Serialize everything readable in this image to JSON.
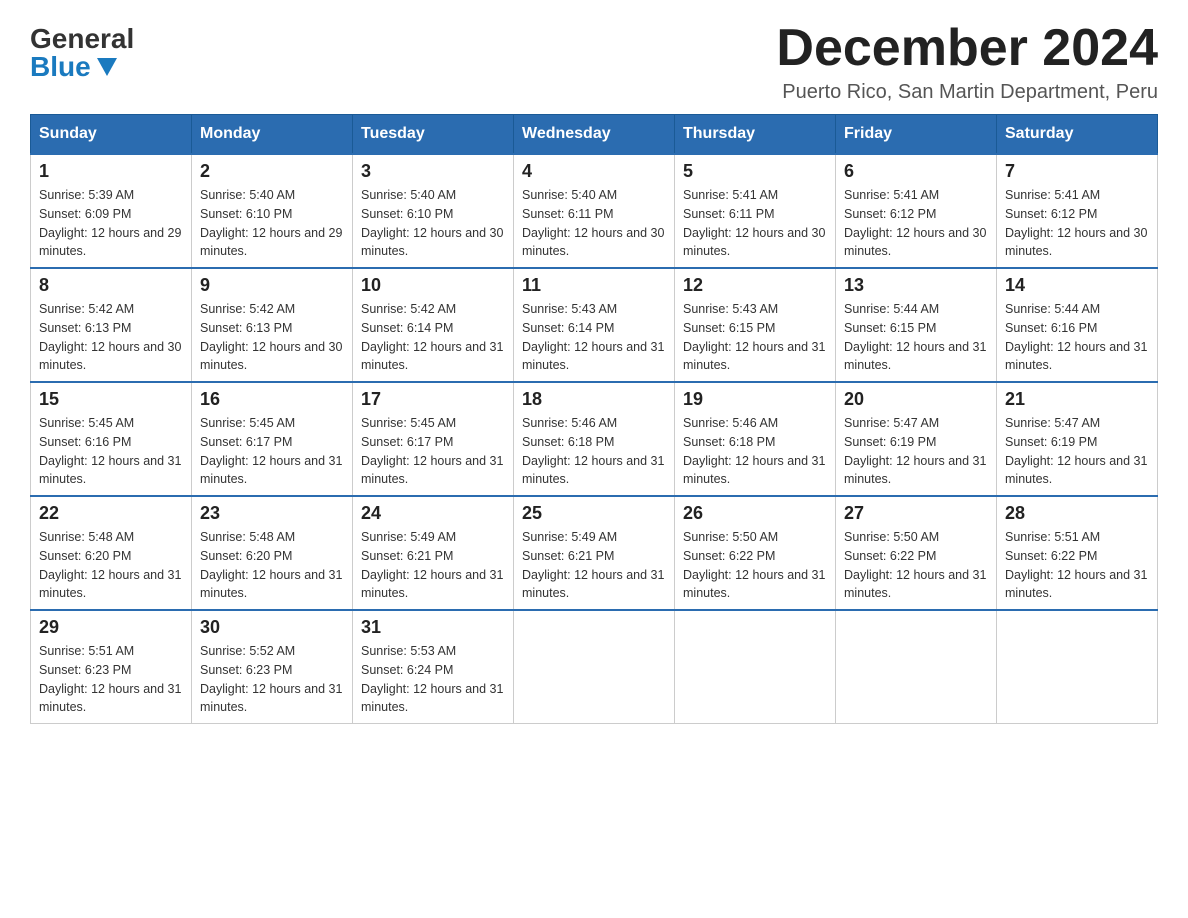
{
  "logo": {
    "general": "General",
    "blue": "Blue"
  },
  "title": {
    "month": "December 2024",
    "location": "Puerto Rico, San Martin Department, Peru"
  },
  "weekdays": [
    "Sunday",
    "Monday",
    "Tuesday",
    "Wednesday",
    "Thursday",
    "Friday",
    "Saturday"
  ],
  "weeks": [
    [
      {
        "day": "1",
        "sunrise": "5:39 AM",
        "sunset": "6:09 PM",
        "daylight": "12 hours and 29 minutes."
      },
      {
        "day": "2",
        "sunrise": "5:40 AM",
        "sunset": "6:10 PM",
        "daylight": "12 hours and 29 minutes."
      },
      {
        "day": "3",
        "sunrise": "5:40 AM",
        "sunset": "6:10 PM",
        "daylight": "12 hours and 30 minutes."
      },
      {
        "day": "4",
        "sunrise": "5:40 AM",
        "sunset": "6:11 PM",
        "daylight": "12 hours and 30 minutes."
      },
      {
        "day": "5",
        "sunrise": "5:41 AM",
        "sunset": "6:11 PM",
        "daylight": "12 hours and 30 minutes."
      },
      {
        "day": "6",
        "sunrise": "5:41 AM",
        "sunset": "6:12 PM",
        "daylight": "12 hours and 30 minutes."
      },
      {
        "day": "7",
        "sunrise": "5:41 AM",
        "sunset": "6:12 PM",
        "daylight": "12 hours and 30 minutes."
      }
    ],
    [
      {
        "day": "8",
        "sunrise": "5:42 AM",
        "sunset": "6:13 PM",
        "daylight": "12 hours and 30 minutes."
      },
      {
        "day": "9",
        "sunrise": "5:42 AM",
        "sunset": "6:13 PM",
        "daylight": "12 hours and 30 minutes."
      },
      {
        "day": "10",
        "sunrise": "5:42 AM",
        "sunset": "6:14 PM",
        "daylight": "12 hours and 31 minutes."
      },
      {
        "day": "11",
        "sunrise": "5:43 AM",
        "sunset": "6:14 PM",
        "daylight": "12 hours and 31 minutes."
      },
      {
        "day": "12",
        "sunrise": "5:43 AM",
        "sunset": "6:15 PM",
        "daylight": "12 hours and 31 minutes."
      },
      {
        "day": "13",
        "sunrise": "5:44 AM",
        "sunset": "6:15 PM",
        "daylight": "12 hours and 31 minutes."
      },
      {
        "day": "14",
        "sunrise": "5:44 AM",
        "sunset": "6:16 PM",
        "daylight": "12 hours and 31 minutes."
      }
    ],
    [
      {
        "day": "15",
        "sunrise": "5:45 AM",
        "sunset": "6:16 PM",
        "daylight": "12 hours and 31 minutes."
      },
      {
        "day": "16",
        "sunrise": "5:45 AM",
        "sunset": "6:17 PM",
        "daylight": "12 hours and 31 minutes."
      },
      {
        "day": "17",
        "sunrise": "5:45 AM",
        "sunset": "6:17 PM",
        "daylight": "12 hours and 31 minutes."
      },
      {
        "day": "18",
        "sunrise": "5:46 AM",
        "sunset": "6:18 PM",
        "daylight": "12 hours and 31 minutes."
      },
      {
        "day": "19",
        "sunrise": "5:46 AM",
        "sunset": "6:18 PM",
        "daylight": "12 hours and 31 minutes."
      },
      {
        "day": "20",
        "sunrise": "5:47 AM",
        "sunset": "6:19 PM",
        "daylight": "12 hours and 31 minutes."
      },
      {
        "day": "21",
        "sunrise": "5:47 AM",
        "sunset": "6:19 PM",
        "daylight": "12 hours and 31 minutes."
      }
    ],
    [
      {
        "day": "22",
        "sunrise": "5:48 AM",
        "sunset": "6:20 PM",
        "daylight": "12 hours and 31 minutes."
      },
      {
        "day": "23",
        "sunrise": "5:48 AM",
        "sunset": "6:20 PM",
        "daylight": "12 hours and 31 minutes."
      },
      {
        "day": "24",
        "sunrise": "5:49 AM",
        "sunset": "6:21 PM",
        "daylight": "12 hours and 31 minutes."
      },
      {
        "day": "25",
        "sunrise": "5:49 AM",
        "sunset": "6:21 PM",
        "daylight": "12 hours and 31 minutes."
      },
      {
        "day": "26",
        "sunrise": "5:50 AM",
        "sunset": "6:22 PM",
        "daylight": "12 hours and 31 minutes."
      },
      {
        "day": "27",
        "sunrise": "5:50 AM",
        "sunset": "6:22 PM",
        "daylight": "12 hours and 31 minutes."
      },
      {
        "day": "28",
        "sunrise": "5:51 AM",
        "sunset": "6:22 PM",
        "daylight": "12 hours and 31 minutes."
      }
    ],
    [
      {
        "day": "29",
        "sunrise": "5:51 AM",
        "sunset": "6:23 PM",
        "daylight": "12 hours and 31 minutes."
      },
      {
        "day": "30",
        "sunrise": "5:52 AM",
        "sunset": "6:23 PM",
        "daylight": "12 hours and 31 minutes."
      },
      {
        "day": "31",
        "sunrise": "5:53 AM",
        "sunset": "6:24 PM",
        "daylight": "12 hours and 31 minutes."
      },
      null,
      null,
      null,
      null
    ]
  ]
}
